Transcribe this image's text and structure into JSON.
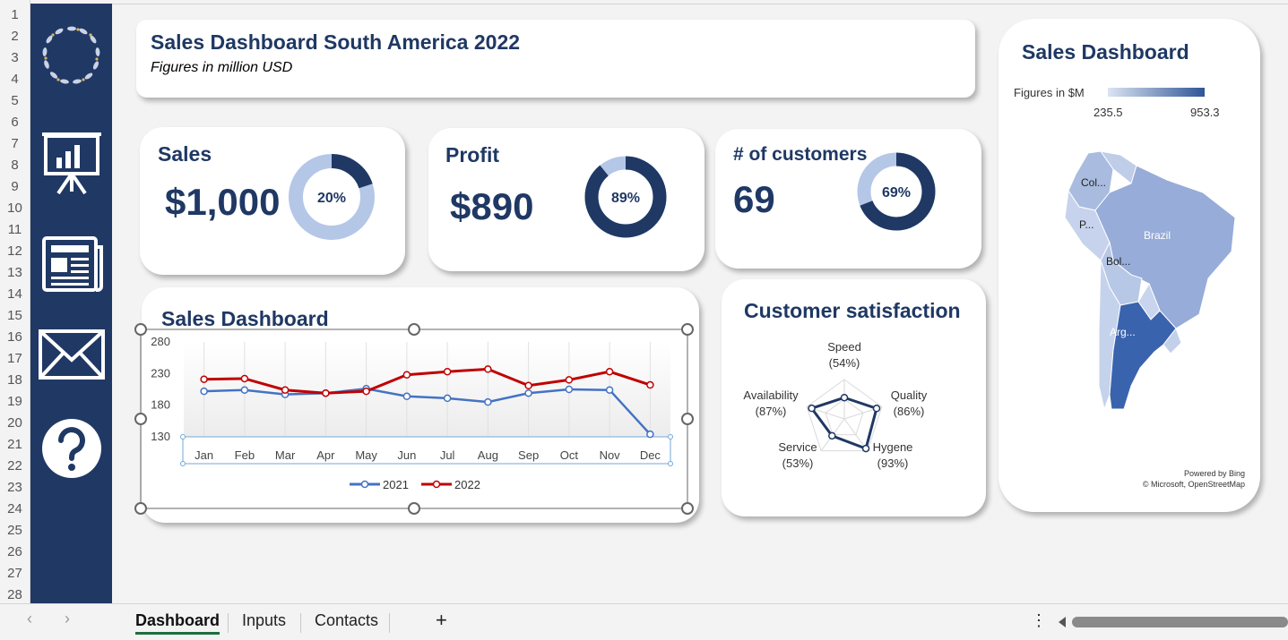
{
  "row_numbers": [
    "1",
    "2",
    "3",
    "4",
    "5",
    "6",
    "7",
    "8",
    "9",
    "10",
    "11",
    "12",
    "13",
    "14",
    "15",
    "16",
    "17",
    "18",
    "19",
    "20",
    "21",
    "22",
    "23",
    "24",
    "25",
    "26",
    "27",
    "28"
  ],
  "sidebar": {
    "icons": [
      "wreath-logo-icon",
      "presentation-chart-icon",
      "newspaper-icon",
      "mail-icon",
      "help-icon"
    ]
  },
  "header": {
    "title": "Sales Dashboard South America 2022",
    "subtitle": "Figures in million USD"
  },
  "kpis": {
    "sales": {
      "label": "Sales",
      "value": "$1,000",
      "percent_text": "20%",
      "percent": 0.2
    },
    "profit": {
      "label": "Profit",
      "value": "$890",
      "percent_text": "89%",
      "percent": 0.89
    },
    "customers": {
      "label": "# of customers",
      "value": "69",
      "percent_text": "69%",
      "percent": 0.69
    }
  },
  "colors": {
    "navy": "#203864",
    "light_blue": "#b4c7e7",
    "line_2021": "#4472c4",
    "line_2022": "#c00000"
  },
  "line_chart": {
    "title": "Sales Dashboard",
    "chart_data": {
      "type": "line",
      "categories": [
        "Jan",
        "Feb",
        "Mar",
        "Apr",
        "May",
        "Jun",
        "Jul",
        "Aug",
        "Sep",
        "Oct",
        "Nov",
        "Dec"
      ],
      "y_ticks": [
        130,
        180,
        230,
        280
      ],
      "ylim": [
        130,
        280
      ],
      "series": [
        {
          "name": "2021",
          "values": [
            202,
            204,
            197,
            199,
            206,
            194,
            191,
            185,
            199,
            205,
            204,
            134
          ]
        },
        {
          "name": "2022",
          "values": [
            221,
            222,
            204,
            199,
            202,
            228,
            233,
            237,
            211,
            220,
            233,
            212
          ]
        }
      ]
    }
  },
  "satisfaction": {
    "title": "Customer satisfaction",
    "chart_data": {
      "type": "radar",
      "axes": [
        {
          "name": "Speed",
          "label": "(54%)",
          "value": 54
        },
        {
          "name": "Quality",
          "label": "(86%)",
          "value": 86
        },
        {
          "name": "Hygene",
          "label": "(93%)",
          "value": 93
        },
        {
          "name": "Service",
          "label": "(53%)",
          "value": 53
        },
        {
          "name": "Availability",
          "label": "(87%)",
          "value": 87
        }
      ],
      "rmax": 100
    }
  },
  "map_card": {
    "title": "Sales Dashboard",
    "legend_label": "Figures in $M",
    "legend_min": "235.5",
    "legend_max": "953.3",
    "region_labels": {
      "colombia": "Col...",
      "peru": "P...",
      "brazil": "Brazil",
      "bolivia": "Bol...",
      "argentina": "Arg..."
    },
    "attribution_1": "Powered by Bing",
    "attribution_2": "© Microsoft, OpenStreetMap"
  },
  "tabs": {
    "items": [
      "Dashboard",
      "Inputs",
      "Contacts"
    ],
    "add_symbol": "+",
    "more_symbol": "⋮",
    "prev_symbol": "‹",
    "next_symbol": "›"
  }
}
